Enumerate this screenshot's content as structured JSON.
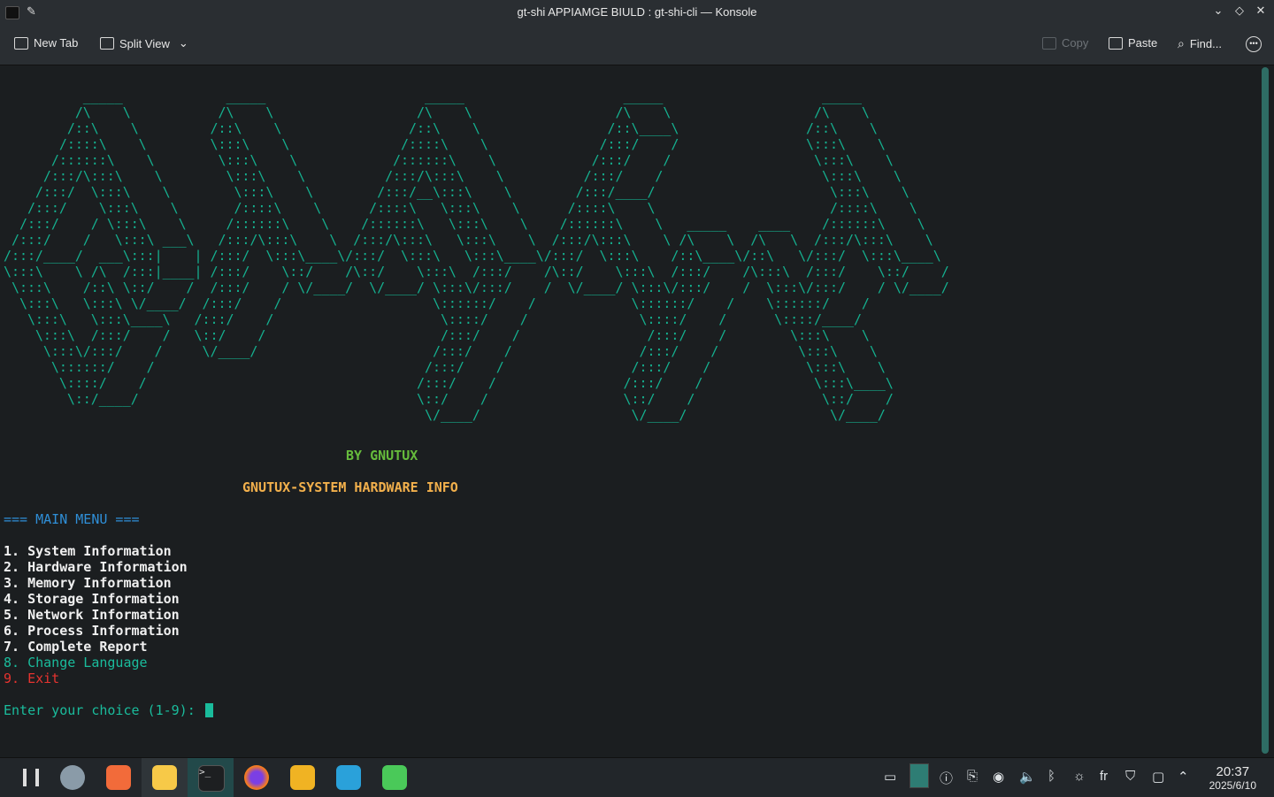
{
  "window": {
    "title": "gt-shi APPIAMGE BIULD : gt-shi-cli — Konsole"
  },
  "toolbar": {
    "new_tab": "New Tab",
    "split_view": "Split View",
    "copy": "Copy",
    "paste": "Paste",
    "find": "Find..."
  },
  "terminal": {
    "ascii_banner": "          _____             _____                    _____                    _____                    _____\n         /\\    \\           /\\    \\                  /\\    \\                  /\\    \\                  /\\    \\\n        /::\\    \\         /::\\    \\                /::\\    \\                /::\\____\\                /::\\    \\\n       /::::\\    \\        \\:::\\    \\              /::::\\    \\              /:::/    /                \\:::\\    \\\n      /::::::\\    \\        \\:::\\    \\            /::::::\\    \\            /:::/    /                  \\:::\\    \\\n     /:::/\\:::\\    \\        \\:::\\    \\          /:::/\\:::\\    \\          /:::/    /                    \\:::\\    \\\n    /:::/  \\:::\\    \\        \\:::\\    \\        /:::/__\\:::\\    \\        /:::/____/                      \\:::\\    \\\n   /:::/    \\:::\\    \\       /::::\\    \\      /::::\\   \\:::\\    \\      /::::\\    \\                      /::::\\    \\\n  /:::/    / \\:::\\    \\     /::::::\\    \\    /::::::\\   \\:::\\    \\    /::::::\\    \\   _____    ____    /::::::\\    \\\n /:::/    /   \\:::\\ ___\\   /:::/\\:::\\    \\  /:::/\\:::\\   \\:::\\    \\  /:::/\\:::\\    \\ /\\    \\  /\\   \\  /:::/\\:::\\    \\\n/:::/____/  ___\\:::|    | /:::/  \\:::\\____\\/:::/  \\:::\\   \\:::\\____\\/:::/  \\:::\\    /::\\____\\/::\\   \\/:::/  \\:::\\____\\\n\\:::\\    \\ /\\  /:::|____| /:::/    \\::/    /\\::/    \\:::\\  /:::/    /\\::/    \\:::\\  /:::/    /\\:::\\  /:::/    \\::/    /\n \\:::\\    /::\\ \\::/    /  /:::/    / \\/____/  \\/____/ \\:::\\/:::/    /  \\/____/ \\:::\\/:::/    /  \\:::\\/:::/    / \\/____/\n  \\:::\\   \\:::\\ \\/____/  /:::/    /                   \\::::::/    /            \\::::::/    /    \\::::::/    /\n   \\:::\\   \\:::\\____\\   /:::/    /                     \\::::/    /              \\::::/    /      \\::::/____/\n    \\:::\\  /:::/    /   \\::/    /                      /:::/    /                /:::/    /        \\:::\\    \\\n     \\:::\\/:::/    /     \\/____/                      /:::/    /                /:::/    /          \\:::\\    \\\n      \\::::::/    /                                  /:::/    /                /:::/    /            \\:::\\    \\\n       \\::::/    /                                  /:::/    /                /:::/    /              \\:::\\____\\\n        \\::/____/                                   \\::/    /                 \\::/    /                \\::/    /\n                                                     \\/____/                   \\/____/                  \\/____/",
    "by_line": "BY GNUTUX",
    "system_line": "GNUTUX-SYSTEM HARDWARE INFO",
    "menu_header": "=== MAIN MENU ===",
    "menu_items": [
      "1. System Information",
      "2. Hardware Information",
      "3. Memory Information",
      "4. Storage Information",
      "5. Network Information",
      "6. Process Information",
      "7. Complete Report",
      "8. Change Language",
      "9. Exit"
    ],
    "prompt": "Enter your choice (1-9): "
  },
  "taskbar": {
    "apps": [
      "app-launcher-icon",
      "system-settings-icon",
      "store-icon",
      "file-manager-icon",
      "konsole-icon",
      "firefox-icon",
      "brave-icon",
      "telegram-icon",
      "whatsapp-icon"
    ],
    "keyboard_layout": "fr",
    "clock_time": "20:37",
    "clock_date": "2025/6/10"
  },
  "colors": {
    "ascii": "#15b08f",
    "by_line": "#66bb3c",
    "system_line": "#f2b04c",
    "menu_header": "#2f8fd8",
    "menu_item": "#f0f0f0",
    "menu_lang": "#1abc9c",
    "menu_exit": "#e5332f",
    "prompt": "#1abc9c"
  }
}
